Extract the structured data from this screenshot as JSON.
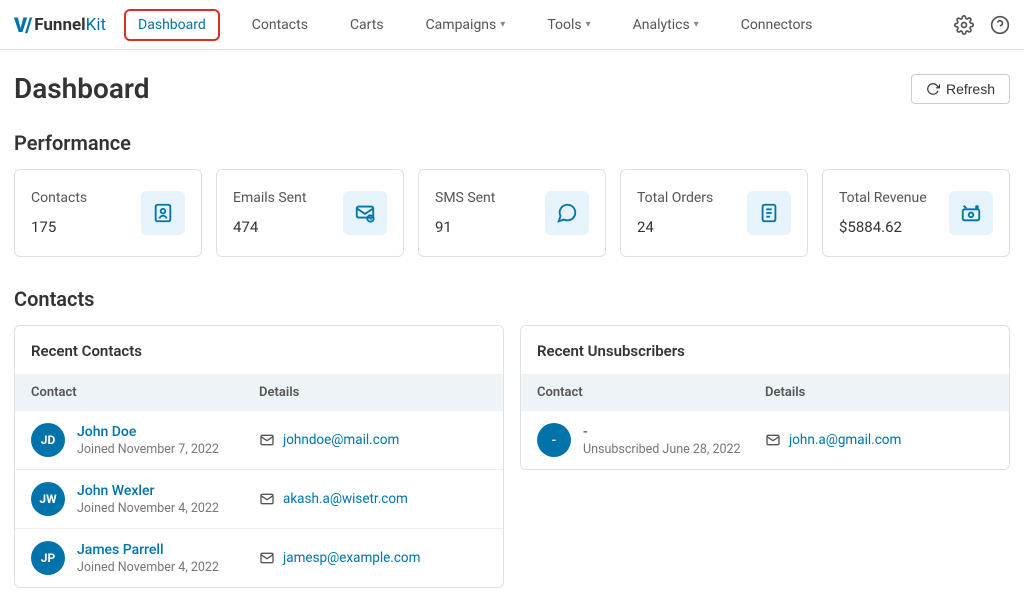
{
  "brand": {
    "funnel": "Funnel",
    "kit": "Kit"
  },
  "nav": {
    "items": [
      {
        "label": "Dashboard",
        "active": true,
        "chevron": false
      },
      {
        "label": "Contacts",
        "active": false,
        "chevron": false
      },
      {
        "label": "Carts",
        "active": false,
        "chevron": false
      },
      {
        "label": "Campaigns",
        "active": false,
        "chevron": true
      },
      {
        "label": "Tools",
        "active": false,
        "chevron": true
      },
      {
        "label": "Analytics",
        "active": false,
        "chevron": true
      },
      {
        "label": "Connectors",
        "active": false,
        "chevron": false
      }
    ]
  },
  "header": {
    "title": "Dashboard",
    "refresh_label": "Refresh"
  },
  "performance": {
    "title": "Performance",
    "cards": [
      {
        "label": "Contacts",
        "value": "175",
        "icon": "contact-card-icon"
      },
      {
        "label": "Emails Sent",
        "value": "474",
        "icon": "envelope-send-icon"
      },
      {
        "label": "SMS Sent",
        "value": "91",
        "icon": "chat-bubble-icon"
      },
      {
        "label": "Total Orders",
        "value": "24",
        "icon": "receipt-icon"
      },
      {
        "label": "Total Revenue",
        "value": "$5884.62",
        "icon": "revenue-icon"
      }
    ]
  },
  "contacts": {
    "title": "Contacts",
    "recent_contacts": {
      "panel_title": "Recent Contacts",
      "col_contact": "Contact",
      "col_details": "Details",
      "rows": [
        {
          "initials": "JD",
          "name": "John Doe",
          "sub": "Joined November 7, 2022",
          "email": "johndoe@mail.com"
        },
        {
          "initials": "JW",
          "name": "John Wexler",
          "sub": "Joined November 4, 2022",
          "email": "akash.a@wisetr.com"
        },
        {
          "initials": "JP",
          "name": "James Parrell",
          "sub": "Joined November 4, 2022",
          "email": "jamesp@example.com"
        }
      ]
    },
    "recent_unsubs": {
      "panel_title": "Recent Unsubscribers",
      "col_contact": "Contact",
      "col_details": "Details",
      "rows": [
        {
          "initials": "-",
          "name": "-",
          "sub": "Unsubscribed June 28, 2022",
          "email": "john.a@gmail.com"
        }
      ]
    }
  }
}
